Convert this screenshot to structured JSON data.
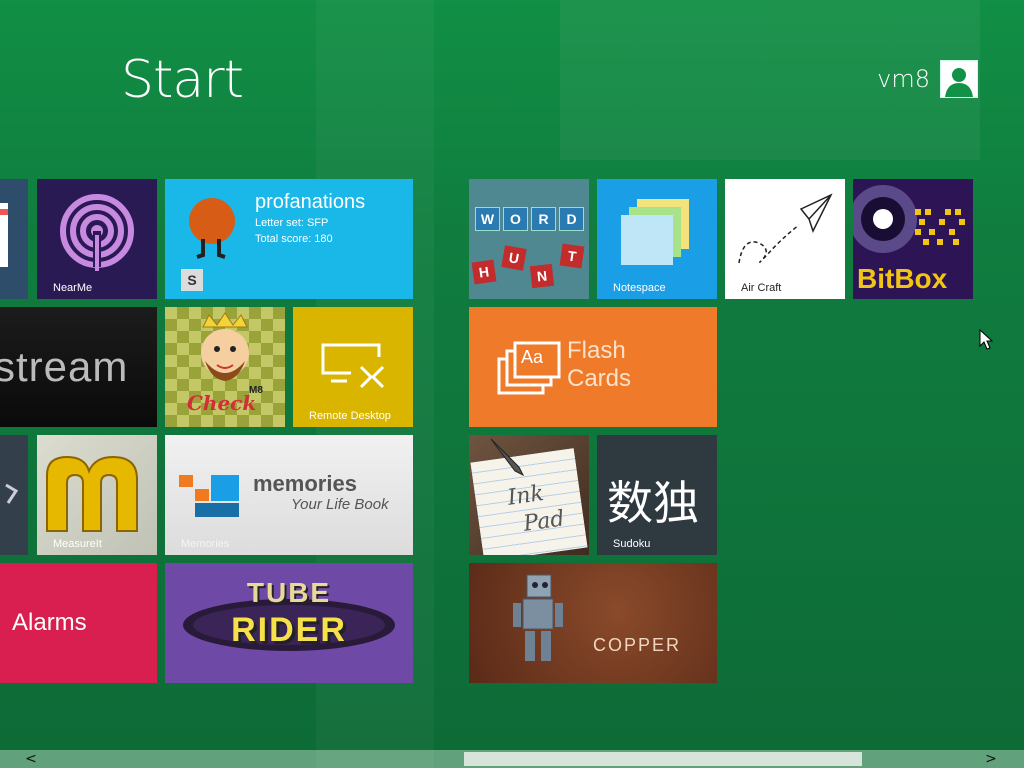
{
  "header": {
    "title": "Start",
    "user_name": "vm8"
  },
  "tiles": {
    "nearme": {
      "label": "NearMe"
    },
    "profanations": {
      "title": "profanations",
      "line1": "Letter set: SFP",
      "line2": "Total score: 180",
      "badge": "S"
    },
    "stream": {
      "text": "stream"
    },
    "checkm8": {
      "text": "Check",
      "sup": "M8"
    },
    "remote": {
      "label": "Remote Desktop"
    },
    "measureit": {
      "label": "MeasureIt"
    },
    "memories": {
      "title": "memories",
      "subtitle": "Your Life Book",
      "label": "Memories"
    },
    "alarms": {
      "label": "Alarms"
    },
    "tuberider": {
      "line1": "TUBE",
      "line2": "RIDER"
    },
    "wordhunt": {
      "letters_top": [
        "W",
        "O",
        "R",
        "D"
      ],
      "letters_bottom": [
        "H",
        "U",
        "N",
        "T"
      ]
    },
    "notespace": {
      "label": "Notespace"
    },
    "aircraft": {
      "label": "Air Craft"
    },
    "bitbox": {
      "text": "BitBox"
    },
    "flashcards": {
      "line1": "Flash",
      "line2": "Cards",
      "icon_text": "Aa"
    },
    "inkpad": {
      "line1": "Ink",
      "line2": "Pad"
    },
    "sudoku": {
      "chars": "数独",
      "label": "Sudoku"
    },
    "copper": {
      "label": "COPPER"
    }
  },
  "colors": {
    "background": "#107d3f",
    "nearme": "#2a1a54",
    "profanations": "#1ab8e8",
    "remote": "#d9b500",
    "memories": "#e8e8e8",
    "alarms": "#d81f4f",
    "tuberider": "#6e4aa6",
    "notespace": "#1a9ee6",
    "flashcards": "#ee7a2a",
    "sudoku": "#2f3a40",
    "copper": "#6b3420"
  },
  "scrollbar": {
    "left_arrow": "<",
    "right_arrow": ">"
  }
}
